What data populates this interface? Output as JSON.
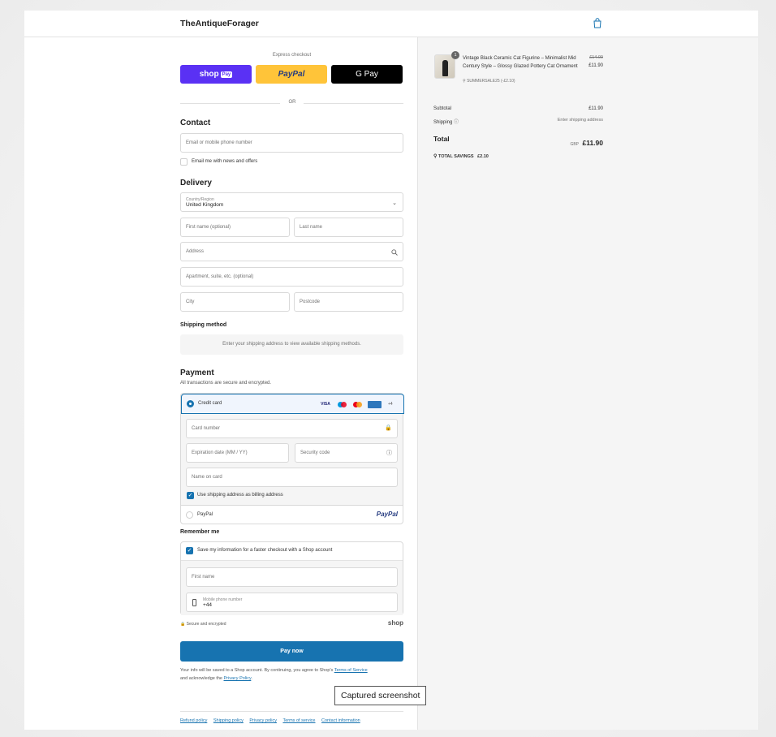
{
  "header": {
    "brand": "TheAntiqueForager",
    "cart_icon": "bag-icon"
  },
  "express": {
    "label": "Express checkout",
    "shop_pay": "shop",
    "shop_pay_tag": "Pay",
    "paypal": "PayPal",
    "gpay": "G Pay",
    "or": "OR"
  },
  "contact": {
    "title": "Contact",
    "email_placeholder": "Email or mobile phone number",
    "news_label": "Email me with news and offers"
  },
  "delivery": {
    "title": "Delivery",
    "country_label": "Country/Region",
    "country_value": "United Kingdom",
    "first_name": "First name (optional)",
    "last_name": "Last name",
    "address": "Address",
    "apartment": "Apartment, suite, etc. (optional)",
    "city": "City",
    "postcode": "Postcode"
  },
  "shipping_method": {
    "title": "Shipping method",
    "notice": "Enter your shipping address to view available shipping methods."
  },
  "payment": {
    "title": "Payment",
    "subtitle": "All transactions are secure and encrypted.",
    "credit_card": "Credit card",
    "card_brands": [
      "VISA",
      "Maestro",
      "Mastercard",
      "AMEX"
    ],
    "more_cards": "+4",
    "card_number": "Card number",
    "expiry": "Expiration date (MM / YY)",
    "security_code": "Security code",
    "name_on_card": "Name on card",
    "billing_same": "Use shipping address as billing address",
    "paypal": "PayPal",
    "paypal_logo": "PayPal"
  },
  "remember": {
    "title": "Remember me",
    "save_info": "Save my information for a faster checkout with a Shop account",
    "first_name": "First name",
    "mobile_label": "Mobile phone number",
    "mobile_value": "+44",
    "secure": "Secure and encrypted",
    "shop": "shop"
  },
  "pay_now": "Pay now",
  "fine_print": {
    "text1": "Your info will be saved to a Shop account. By continuing, you agree to Shop's ",
    "tos": "Terms of Service",
    "text2": "and acknowledge the ",
    "privacy": "Privacy Policy",
    "text3": "."
  },
  "footer": [
    "Refund policy",
    "Shipping policy",
    "Privacy policy",
    "Terms of service",
    "Contact information"
  ],
  "tooltip": "Captured screenshot",
  "summary": {
    "product_qty": "1",
    "product_name": "Vintage Black Ceramic Cat Figurine – Minimalist Mid Century Style – Glossy Glazed Pottery Cat Ornament",
    "discount_code": "SUMMERSALE25 (-£2.10)",
    "original_price": "£14.00",
    "price": "£11.90",
    "subtotal_label": "Subtotal",
    "subtotal_value": "£11.90",
    "shipping_label": "Shipping",
    "shipping_value": "Enter shipping address",
    "total_label": "Total",
    "currency": "GBP",
    "total_value": "£11.90",
    "savings_label": "TOTAL SAVINGS",
    "savings_value": "£2.10"
  }
}
